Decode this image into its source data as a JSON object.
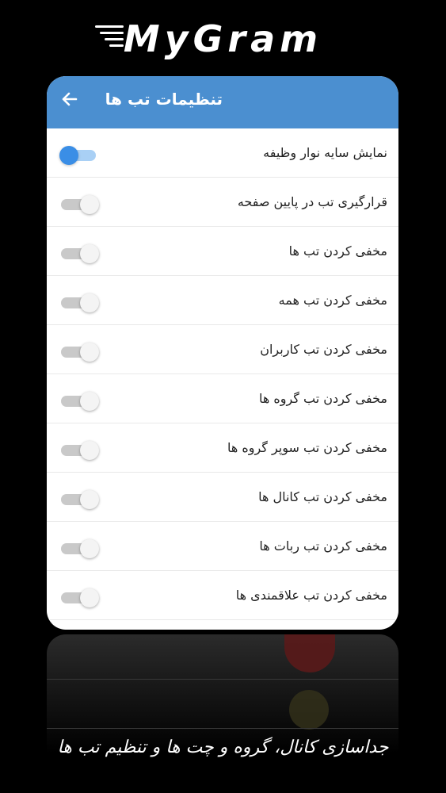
{
  "brand": {
    "name": "MyGram"
  },
  "header": {
    "title": "تنظیمات تب ها",
    "back_icon": "arrow-left-icon",
    "background_color": "#4b8fd0"
  },
  "settings": [
    {
      "label": "نمایش سایه نوار وظیفه",
      "enabled": true
    },
    {
      "label": "قرارگیری تب در پایین صفحه",
      "enabled": false
    },
    {
      "label": "مخفی کردن تب ها",
      "enabled": false
    },
    {
      "label": "مخفی کردن تب همه",
      "enabled": false
    },
    {
      "label": "مخفی کردن تب کاربران",
      "enabled": false
    },
    {
      "label": "مخفی کردن تب گروه ها",
      "enabled": false
    },
    {
      "label": "مخفی کردن تب سوپر گروه ها",
      "enabled": false
    },
    {
      "label": "مخفی کردن تب کانال ها",
      "enabled": false
    },
    {
      "label": "مخفی کردن تب ربات ها",
      "enabled": false
    },
    {
      "label": "مخفی کردن تب علاقمندی ها",
      "enabled": false
    }
  ],
  "colors": {
    "switch_on": "#3a8ee6",
    "switch_on_track": "#a9d0f5",
    "switch_off": "#f4f4f4",
    "switch_off_track": "#c9c9c9"
  },
  "caption": "جداسازی کانال، گروه و چت ها و تنظیم تب ها"
}
